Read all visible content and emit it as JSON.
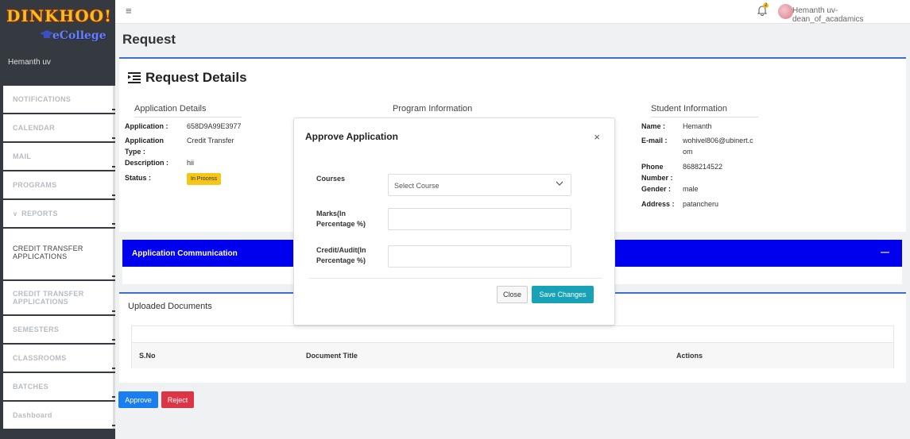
{
  "brand": {
    "name": "DINKHOO!",
    "sub": "eCollege"
  },
  "sidebar": {
    "user": "Hemanth uv",
    "items": [
      {
        "label": "NOTIFICATIONS"
      },
      {
        "label": "CALENDAR"
      },
      {
        "label": "MAIL"
      },
      {
        "label": "PROGRAMS"
      },
      {
        "label": "REPORTS"
      },
      {
        "label": "CREDIT TRANSFER APPLICATIONS"
      },
      {
        "label": "CREDIT TRANSFER APPLICATIONS"
      },
      {
        "label": "SEMESTERS"
      },
      {
        "label": "CLASSROOMS"
      },
      {
        "label": "BATCHES"
      },
      {
        "label": "Dashboard"
      }
    ]
  },
  "topbar": {
    "notification_count": "2",
    "user": "Hemanth uv- dean_of_acadamics"
  },
  "page": {
    "title": "Request"
  },
  "details": {
    "title": "Request Details",
    "app_head": "Application Details",
    "prog_head": "Program Information",
    "student_head": "Student Information",
    "application": {
      "k": "Application :",
      "v": "658D9A99E3977"
    },
    "app_type": {
      "k1": "Application",
      "k2": "Type :",
      "v": "Credit Transfer"
    },
    "description": {
      "k": "Description :",
      "v": "hii"
    },
    "status": {
      "k": "Status :",
      "v": "In Process"
    },
    "name": {
      "k": "Name :",
      "v": "Hemanth"
    },
    "email": {
      "k": "E-mail :",
      "v1": "wohivel806@ubinert.c",
      "v2": "om"
    },
    "phone": {
      "k1": "Phone",
      "k2": "Number :",
      "v": "8688214522"
    },
    "gender": {
      "k": "Gender :",
      "v": "male"
    },
    "address": {
      "k": "Address :",
      "v": "patancheru"
    }
  },
  "communication": {
    "title": "Application Communication"
  },
  "documents": {
    "title": "Uploaded Documents",
    "columns": [
      "S.No",
      "Document Title",
      "Actions"
    ]
  },
  "actions": {
    "approve": "Approve",
    "reject": "Reject"
  },
  "modal": {
    "title": "Approve Application",
    "courses_label": "Courses",
    "select_placeholder": "Select Course",
    "marks_label_1": "Marks(In",
    "marks_label_2": "Percentage %)",
    "credit_label_1": "Credit/Audit(In",
    "credit_label_2": "Percentage %)",
    "close": "Close",
    "save": "Save Changes"
  },
  "colors": {
    "sidebar": "#343a40",
    "primary": "#1b7ef0",
    "danger": "#dc3545",
    "comm_bar": "#0000ee",
    "save": "#17a2b8",
    "status_badge": "#f5c518"
  }
}
